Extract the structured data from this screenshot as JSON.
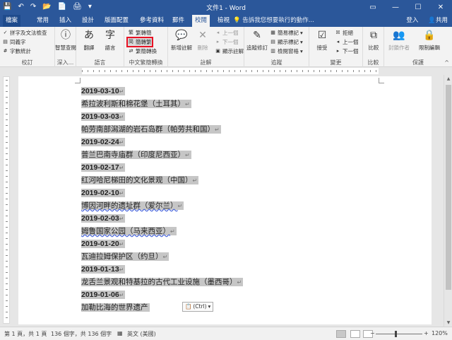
{
  "titlebar": {
    "title": "文件1 - Word",
    "qat": [
      "💾",
      "↶",
      "↷",
      "📂",
      "📄",
      "🖨",
      "▾"
    ],
    "window_buttons": [
      "▭",
      "—",
      "☐",
      "✕"
    ]
  },
  "tabs": [
    "檔案",
    "常用",
    "插入",
    "設計",
    "版面配置",
    "參考資料",
    "郵件",
    "校閱",
    "檢視"
  ],
  "active_tab": "校閱",
  "tell_me": "告訴我您想要執行的動作...",
  "account": {
    "sign_in": "登入",
    "share": "共用"
  },
  "ribbon": {
    "proofing": {
      "label": "校訂",
      "spell": "拼字及文法檢查",
      "thesaurus": "同義字",
      "wordcount": "字數統計"
    },
    "insights": {
      "label": "深入...",
      "smart_lookup": "智慧查閱"
    },
    "language": {
      "label": "語言",
      "translate": "翻譯",
      "lang": "語言"
    },
    "chinese": {
      "label": "中文繁簡轉換",
      "to_trad": "繁轉簡",
      "to_simp": "簡轉繁",
      "convert": "繁簡轉換"
    },
    "comments": {
      "label": "註解",
      "new": "新增註解",
      "delete": "刪除",
      "prev": "上一個",
      "next": "下一個",
      "show": "顯示註解"
    },
    "tracking": {
      "label": "追蹤",
      "track": "追蹤修訂",
      "simple": "簡易標記",
      "show_markup": "顯示標記",
      "pane": "檢閱窗格"
    },
    "changes": {
      "label": "變更",
      "accept": "接受",
      "reject": "拒絕",
      "prev": "上一個",
      "next": "下一個"
    },
    "compare": {
      "label": "比較",
      "compare": "比較"
    },
    "protect": {
      "label": "保護",
      "block": "封鎖作者",
      "restrict": "限制編輯"
    }
  },
  "document": {
    "lines": [
      {
        "text": "2019-03-10",
        "type": "date"
      },
      {
        "text": "希拉波利斯和棉花堡（土耳其）",
        "type": "name"
      },
      {
        "text": "2019-03-03",
        "type": "date"
      },
      {
        "text": "帕劳南部潟湖的岩石岛群（帕劳共和国）",
        "type": "name"
      },
      {
        "text": "2019-02-24",
        "type": "date"
      },
      {
        "text": "普兰巴南寺庙群（印度尼西亚）",
        "type": "name"
      },
      {
        "text": "2019-02-17",
        "type": "date"
      },
      {
        "text": "红河哈尼梯田的文化景观（中国）",
        "type": "name"
      },
      {
        "text": "2019-02-10",
        "type": "date"
      },
      {
        "text": "博因河畔的遗址群（爱尔兰）",
        "type": "name"
      },
      {
        "text": "2019-02-03",
        "type": "date"
      },
      {
        "text": "姆鲁国家公园（马来西亚）",
        "type": "name"
      },
      {
        "text": "2019-01-20",
        "type": "date"
      },
      {
        "text": "瓦迪拉姆保护区（约旦）",
        "type": "name"
      },
      {
        "text": "2019-01-13",
        "type": "date"
      },
      {
        "text": "龙舌兰景观和特基拉的古代工业设施（墨西哥）",
        "type": "name"
      },
      {
        "text": "2019-01-06",
        "type": "date"
      },
      {
        "text": "加勒比海的世界遗产",
        "type": "name"
      }
    ],
    "paragraph_mark": "↵",
    "paste_options": "(Ctrl)"
  },
  "status": {
    "page": "第 1 頁，共 1 頁",
    "words": "136 個字，共 136 個字",
    "language": "英文 (美國)",
    "zoom": "120%",
    "zoom_minus": "−",
    "zoom_plus": "+"
  }
}
